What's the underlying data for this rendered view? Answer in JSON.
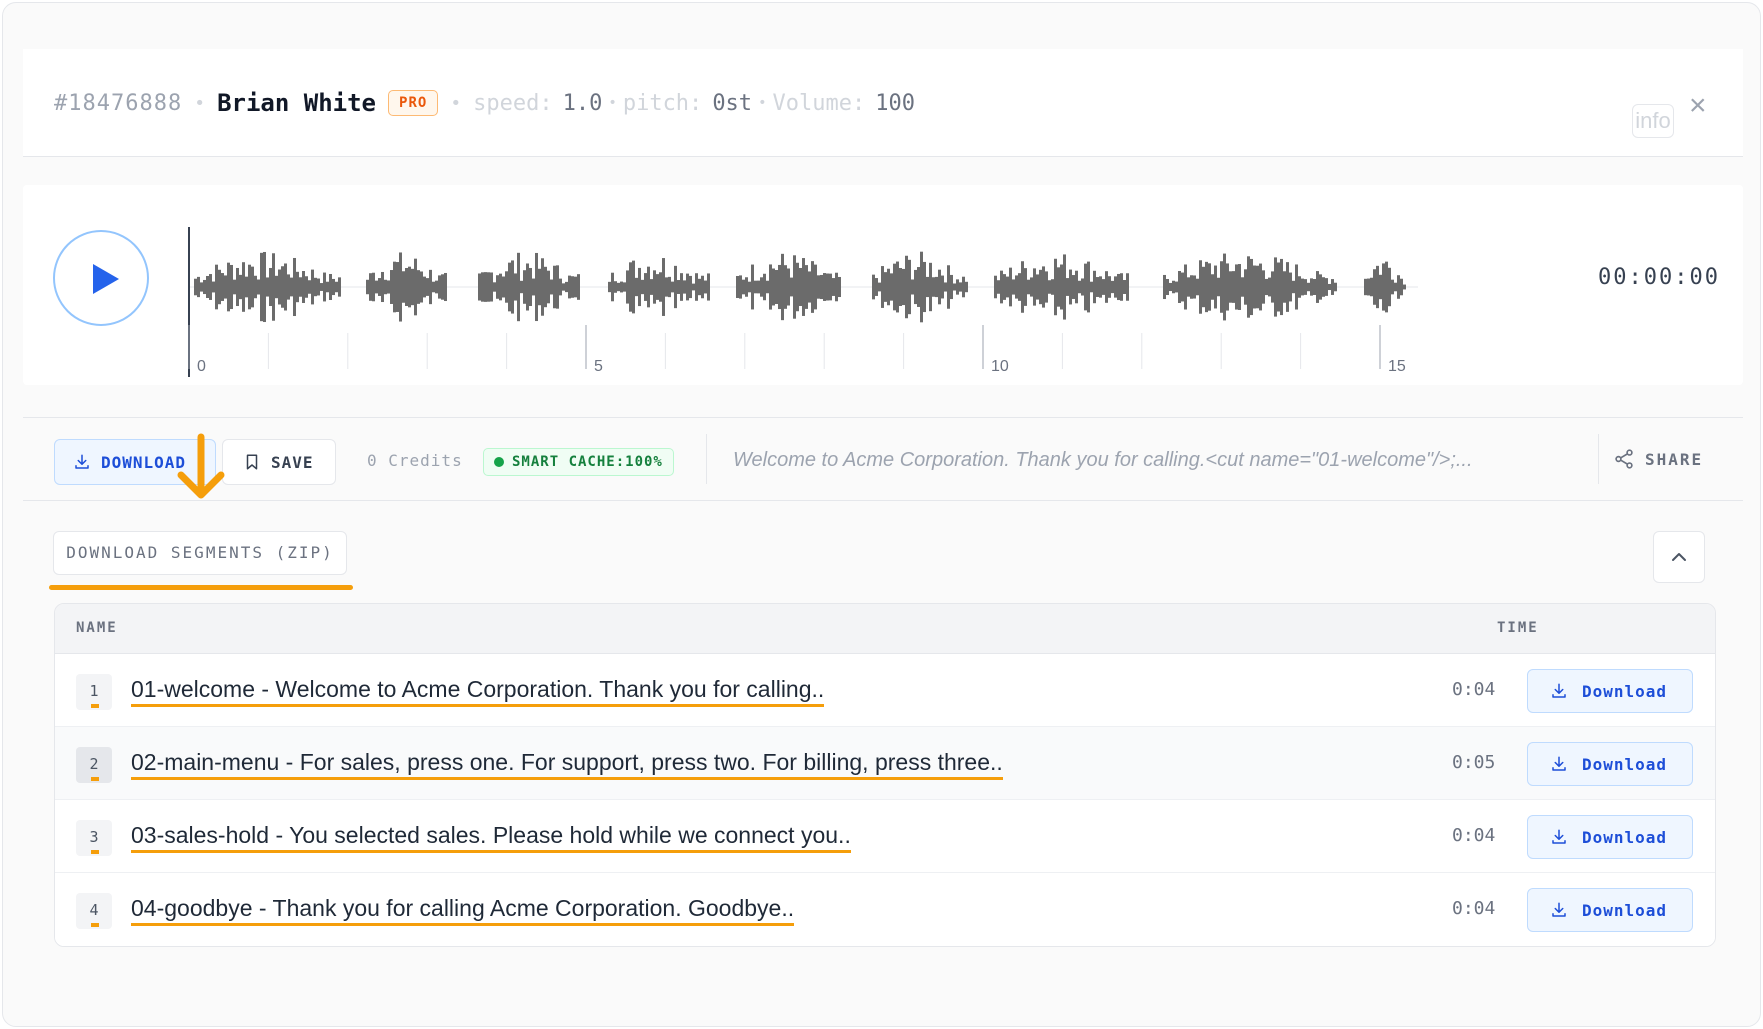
{
  "header": {
    "id": "#18476888",
    "separator": "•",
    "voice_name": "Brian White",
    "tier_badge": "PRO",
    "speed_label": "speed:",
    "speed_value": "1.0",
    "pitch_label": "pitch:",
    "pitch_value": "0st",
    "volume_label": "Volume:",
    "volume_value": "100",
    "info_label": "info",
    "close_icon": "×"
  },
  "player": {
    "time": "00:00:00",
    "timeline_ticks": [
      "0",
      "5",
      "10",
      "15"
    ],
    "timeline_max_seconds": 15.5
  },
  "toolbar": {
    "download_label": "DOWNLOAD",
    "save_label": "SAVE",
    "credits": "0 Credits",
    "cache_label": "SMART CACHE:100%",
    "script_preview": "Welcome to Acme Corporation. Thank you for calling.<cut name=\"01-welcome\"/>;...",
    "share_label": "SHARE"
  },
  "segments": {
    "zip_button": "DOWNLOAD SEGMENTS (ZIP)",
    "columns": {
      "name": "NAME",
      "time": "TIME"
    },
    "rows": [
      {
        "num": "1",
        "text": "01-welcome - Welcome to Acme Corporation. Thank you for calling..",
        "time": "0:04",
        "action": "Download"
      },
      {
        "num": "2",
        "text": "02-main-menu - For sales, press one. For support, press two. For billing, press three..",
        "time": "0:05",
        "action": "Download"
      },
      {
        "num": "3",
        "text": "03-sales-hold - You selected sales. Please hold while we connect you..",
        "time": "0:04",
        "action": "Download"
      },
      {
        "num": "4",
        "text": "04-goodbye - Thank you for calling Acme Corporation. Goodbye..",
        "time": "0:04",
        "action": "Download"
      }
    ]
  },
  "colors": {
    "accent": "#2563eb",
    "highlight": "#f59e0b",
    "cache_green": "#16a34a",
    "waveform": "#6b6b6b"
  },
  "icons": {
    "play": "play-icon",
    "download": "download-icon",
    "save": "bookmark-icon",
    "share": "share-icon",
    "collapse": "chevron-up-icon",
    "close": "close-icon"
  }
}
